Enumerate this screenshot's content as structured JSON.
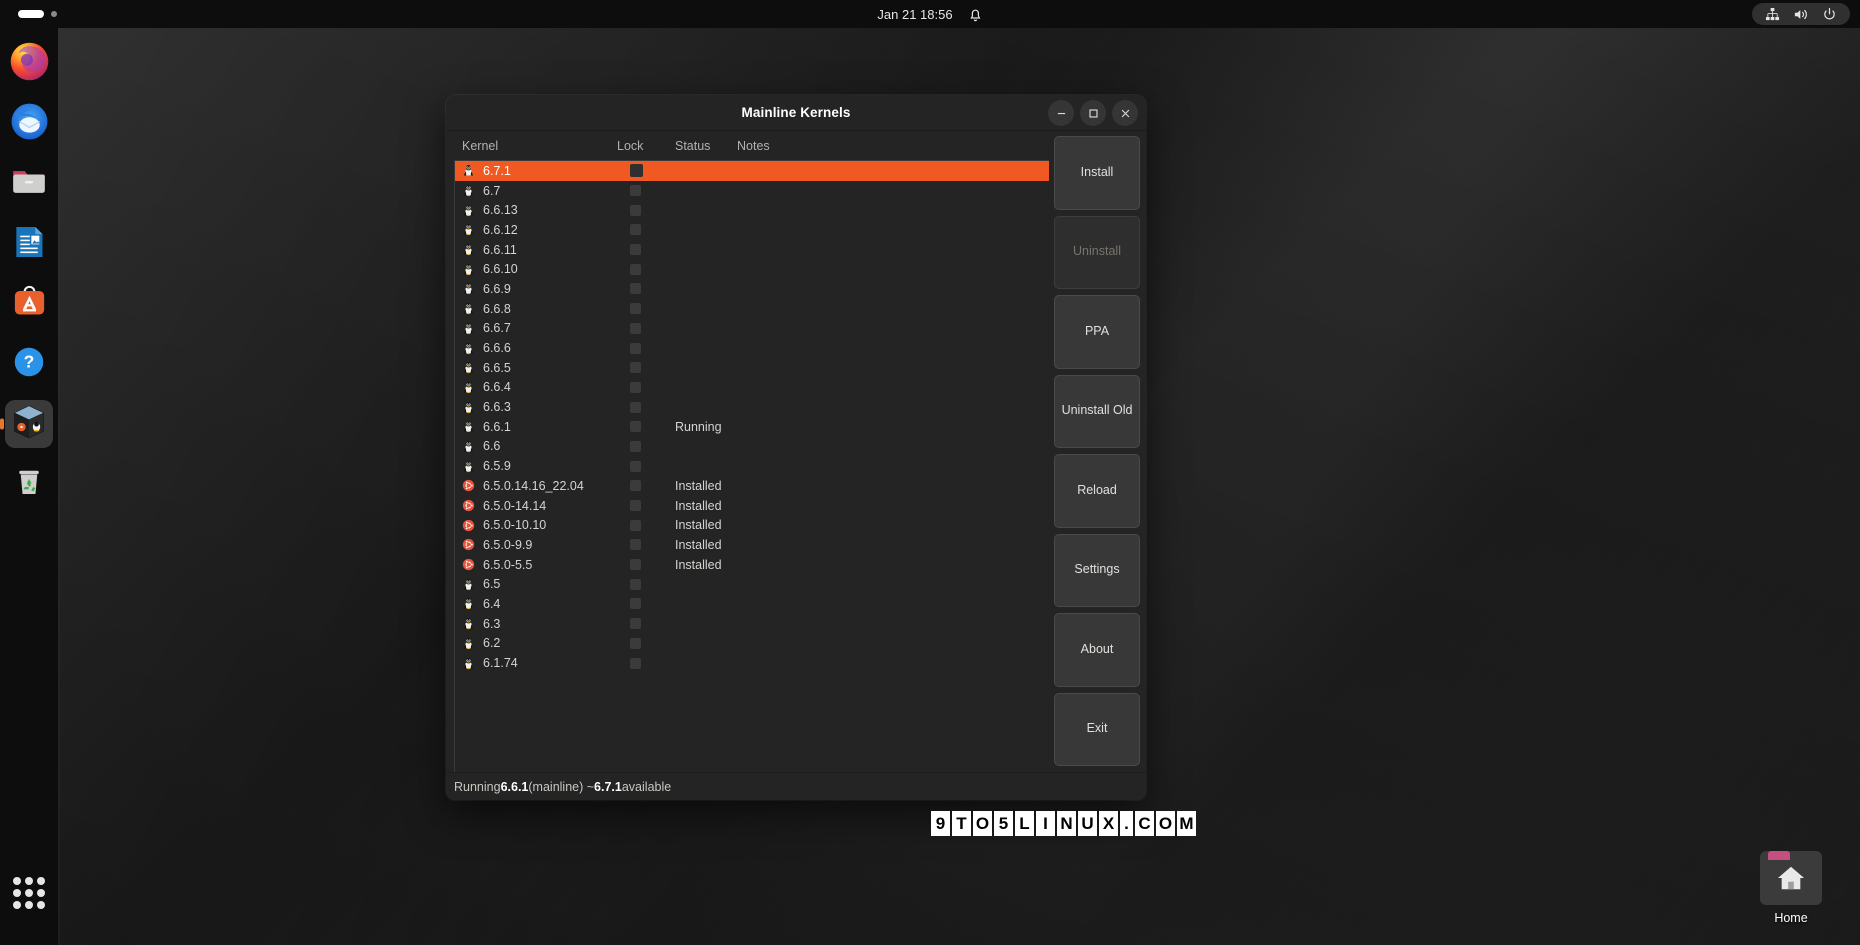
{
  "topbar": {
    "clock": "Jan 21  18:56",
    "bell_icon": "bell-icon",
    "tray_icons": [
      "network-wired-icon",
      "volume-icon",
      "power-icon"
    ],
    "workspace_icon": "workspace-indicator"
  },
  "dock": {
    "items": [
      {
        "name": "firefox",
        "label": "Firefox",
        "icon": "firefox-icon",
        "active": false
      },
      {
        "name": "thunderbird",
        "label": "Thunderbird",
        "icon": "thunderbird-icon",
        "active": false
      },
      {
        "name": "files",
        "label": "Files",
        "icon": "files-folder-icon",
        "active": false
      },
      {
        "name": "libreoffice-writer",
        "label": "LibreOffice Writer",
        "icon": "document-icon",
        "active": false
      },
      {
        "name": "ubuntu-software",
        "label": "Ubuntu Software",
        "icon": "software-bag-icon",
        "active": false
      },
      {
        "name": "help",
        "label": "Help",
        "icon": "question-circle-icon",
        "active": false
      },
      {
        "name": "mainline",
        "label": "Mainline",
        "icon": "cube-box-icon",
        "active": true
      },
      {
        "name": "trash",
        "label": "Trash",
        "icon": "trash-recycle-icon",
        "active": false
      }
    ],
    "show_apps_label": "Show Applications"
  },
  "desktop": {
    "home_icon_label": "Home"
  },
  "window": {
    "title": "Mainline Kernels",
    "controls": {
      "minimize": "minimize-icon",
      "maximize": "maximize-icon",
      "close": "close-icon"
    },
    "columns": {
      "kernel": "Kernel",
      "lock": "Lock",
      "status": "Status",
      "notes": "Notes"
    },
    "rows": [
      {
        "kernel": "6.7.1",
        "icon": "tux-icon",
        "lock": false,
        "status": "",
        "notes": "",
        "selected": true
      },
      {
        "kernel": "6.7",
        "icon": "tux-icon",
        "lock": false,
        "status": "",
        "notes": "",
        "selected": false
      },
      {
        "kernel": "6.6.13",
        "icon": "tux-icon",
        "lock": false,
        "status": "",
        "notes": "",
        "selected": false
      },
      {
        "kernel": "6.6.12",
        "icon": "tux-icon",
        "lock": false,
        "status": "",
        "notes": "",
        "selected": false
      },
      {
        "kernel": "6.6.11",
        "icon": "tux-icon",
        "lock": false,
        "status": "",
        "notes": "",
        "selected": false
      },
      {
        "kernel": "6.6.10",
        "icon": "tux-icon",
        "lock": false,
        "status": "",
        "notes": "",
        "selected": false
      },
      {
        "kernel": "6.6.9",
        "icon": "tux-icon",
        "lock": false,
        "status": "",
        "notes": "",
        "selected": false
      },
      {
        "kernel": "6.6.8",
        "icon": "tux-icon",
        "lock": false,
        "status": "",
        "notes": "",
        "selected": false
      },
      {
        "kernel": "6.6.7",
        "icon": "tux-icon",
        "lock": false,
        "status": "",
        "notes": "",
        "selected": false
      },
      {
        "kernel": "6.6.6",
        "icon": "tux-icon",
        "lock": false,
        "status": "",
        "notes": "",
        "selected": false
      },
      {
        "kernel": "6.6.5",
        "icon": "tux-icon",
        "lock": false,
        "status": "",
        "notes": "",
        "selected": false
      },
      {
        "kernel": "6.6.4",
        "icon": "tux-icon",
        "lock": false,
        "status": "",
        "notes": "",
        "selected": false
      },
      {
        "kernel": "6.6.3",
        "icon": "tux-icon",
        "lock": false,
        "status": "",
        "notes": "",
        "selected": false
      },
      {
        "kernel": "6.6.1",
        "icon": "tux-icon",
        "lock": false,
        "status": "Running",
        "notes": "",
        "selected": false
      },
      {
        "kernel": "6.6",
        "icon": "tux-icon",
        "lock": false,
        "status": "",
        "notes": "",
        "selected": false
      },
      {
        "kernel": "6.5.9",
        "icon": "tux-icon",
        "lock": false,
        "status": "",
        "notes": "",
        "selected": false
      },
      {
        "kernel": "6.5.0.14.16_22.04",
        "icon": "ubuntu-icon",
        "lock": false,
        "status": "Installed",
        "notes": "",
        "selected": false
      },
      {
        "kernel": "6.5.0-14.14",
        "icon": "ubuntu-icon",
        "lock": false,
        "status": "Installed",
        "notes": "",
        "selected": false
      },
      {
        "kernel": "6.5.0-10.10",
        "icon": "ubuntu-icon",
        "lock": false,
        "status": "Installed",
        "notes": "",
        "selected": false
      },
      {
        "kernel": "6.5.0-9.9",
        "icon": "ubuntu-icon",
        "lock": false,
        "status": "Installed",
        "notes": "",
        "selected": false
      },
      {
        "kernel": "6.5.0-5.5",
        "icon": "ubuntu-icon",
        "lock": false,
        "status": "Installed",
        "notes": "",
        "selected": false
      },
      {
        "kernel": "6.5",
        "icon": "tux-icon",
        "lock": false,
        "status": "",
        "notes": "",
        "selected": false
      },
      {
        "kernel": "6.4",
        "icon": "tux-icon",
        "lock": false,
        "status": "",
        "notes": "",
        "selected": false
      },
      {
        "kernel": "6.3",
        "icon": "tux-icon",
        "lock": false,
        "status": "",
        "notes": "",
        "selected": false
      },
      {
        "kernel": "6.2",
        "icon": "tux-icon",
        "lock": false,
        "status": "",
        "notes": "",
        "selected": false
      },
      {
        "kernel": "6.1.74",
        "icon": "tux-icon",
        "lock": false,
        "status": "",
        "notes": "",
        "selected": false
      }
    ],
    "buttons": [
      {
        "name": "install",
        "label": "Install",
        "disabled": false
      },
      {
        "name": "uninstall",
        "label": "Uninstall",
        "disabled": true
      },
      {
        "name": "ppa",
        "label": "PPA",
        "disabled": false
      },
      {
        "name": "uninstall-old",
        "label": "Uninstall Old",
        "disabled": false
      },
      {
        "name": "reload",
        "label": "Reload",
        "disabled": false
      },
      {
        "name": "settings",
        "label": "Settings",
        "disabled": false
      },
      {
        "name": "about",
        "label": "About",
        "disabled": false
      },
      {
        "name": "exit",
        "label": "Exit",
        "disabled": false
      }
    ],
    "statusbar": {
      "prefix": "Running ",
      "running_version": "6.6.1",
      "middle": " (mainline) ~ ",
      "available_version": "6.7.1",
      "suffix": " available"
    }
  },
  "watermark": {
    "text": "9TO5LINUX.COM"
  },
  "colors": {
    "accent": "#f05a22",
    "topbar_bg": "#0d0d0d",
    "window_bg": "#242424",
    "button_bg": "#383838"
  }
}
